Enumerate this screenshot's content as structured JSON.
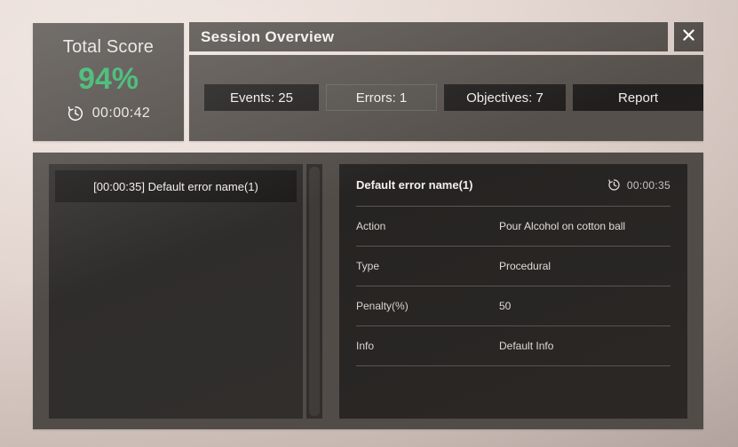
{
  "score_card": {
    "title": "Total Score",
    "value": "94%",
    "timer": "00:00:42",
    "timer_icon": "clock-history-icon",
    "value_color": "#35b56b"
  },
  "header": {
    "title": "Session Overview",
    "close_icon": "close-icon"
  },
  "tabs": [
    {
      "label": "Events: 25",
      "selected": false
    },
    {
      "label": "Errors: 1",
      "selected": true
    },
    {
      "label": "Objectives: 7",
      "selected": false
    },
    {
      "label": "Report",
      "selected": false
    }
  ],
  "list": {
    "items": [
      {
        "label": "[00:00:35] Default error name(1)",
        "selected": true
      }
    ],
    "scrollbar": "vertical-scrollbar"
  },
  "detail": {
    "title": "Default error name(1)",
    "time": "00:00:35",
    "time_icon": "clock-history-icon",
    "rows": [
      {
        "label": "Action",
        "value": "Pour Alcohol on cotton ball"
      },
      {
        "label": "Type",
        "value": "Procedural"
      },
      {
        "label": "Penalty(%)",
        "value": "50"
      },
      {
        "label": "Info",
        "value": "Default Info"
      }
    ]
  }
}
